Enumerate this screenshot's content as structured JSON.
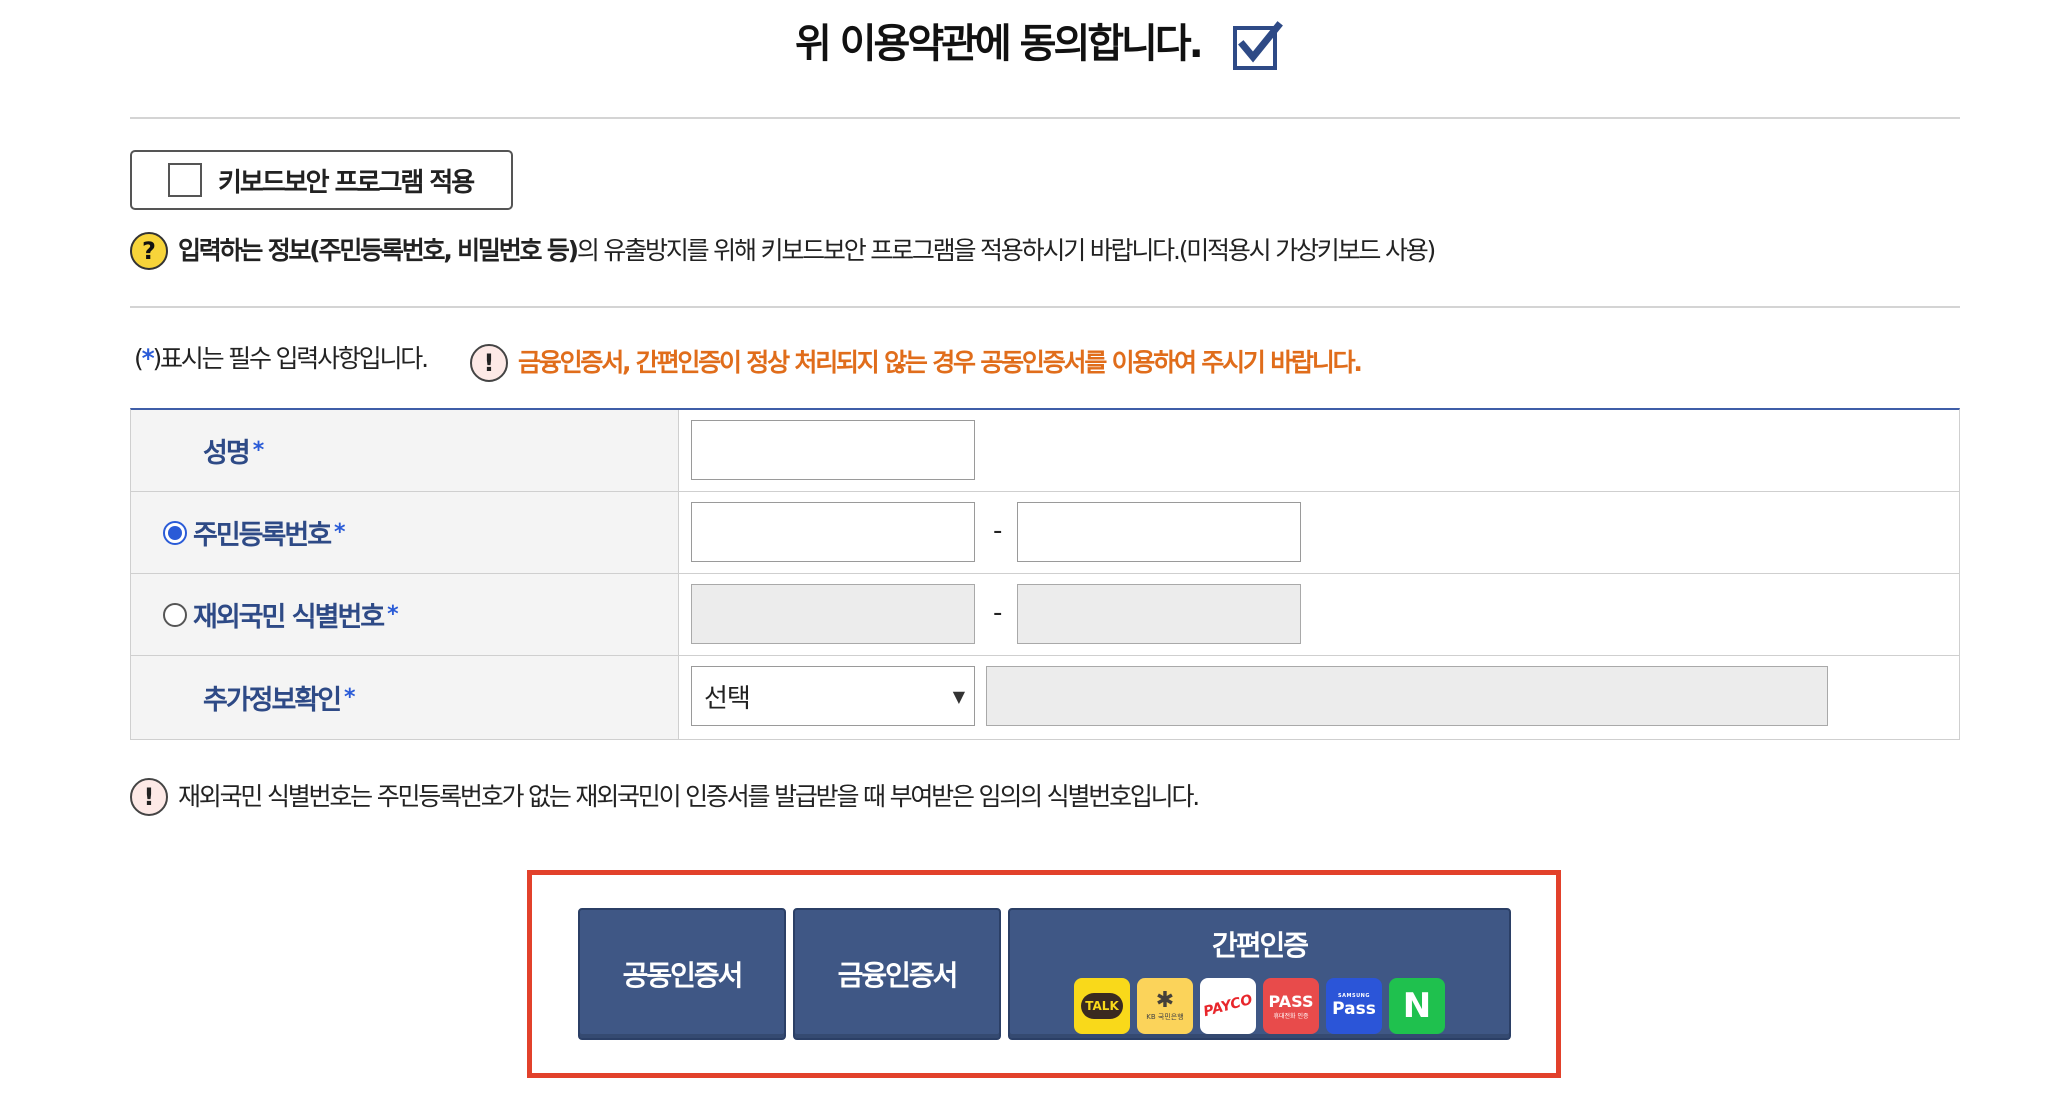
{
  "agree": {
    "title": "위 이용약관에 동의합니다.",
    "checked": true
  },
  "keyboard_security": {
    "label": "키보드보안 프로그램 적용",
    "help_bold": "입력하는 정보(주민등록번호, 비밀번호 등)",
    "help_rest": "의 유출방지를 위해 키보드보안 프로그램을 적용하시기 바랍니다.(미적용시 가상키보드 사용)"
  },
  "notice": {
    "required_prefix": "(",
    "required_star": "*",
    "required_suffix": ")표시는 필수 입력사항입니다.",
    "warning": "금융인증서, 간편인증이 정상 처리되지 않는 경우 공동인증서를 이용하여 주시기 바랍니다."
  },
  "form": {
    "name_label": "성명",
    "rrn_label": "주민등록번호",
    "foreign_label": "재외국민 식별번호",
    "extra_label": "추가정보확인",
    "star": "*",
    "dash": "-",
    "extra_select_value": "선택",
    "selected_id_type": "rrn"
  },
  "footnote": "재외국민 식별번호는 주민등록번호가 없는 재외국민이 인증서를 발급받을 때 부여받은 임의의 식별번호입니다.",
  "cert_buttons": {
    "joint": "공동인증서",
    "financial": "금융인증서",
    "simple": "간편인증",
    "logos": {
      "talk": "TALK",
      "kb": "KB 국민은행",
      "payco": "PAYCO",
      "pass": "PASS",
      "pass_sub": "휴대전화 인증",
      "samsung_top": "SAMSUNG",
      "samsung_pass": "Pass",
      "naver": "N"
    }
  },
  "colors": {
    "accent": "#3f5785",
    "highlight_frame": "#e2412b",
    "warning_text": "#e06d1b",
    "label_blue": "#2e4a86"
  }
}
